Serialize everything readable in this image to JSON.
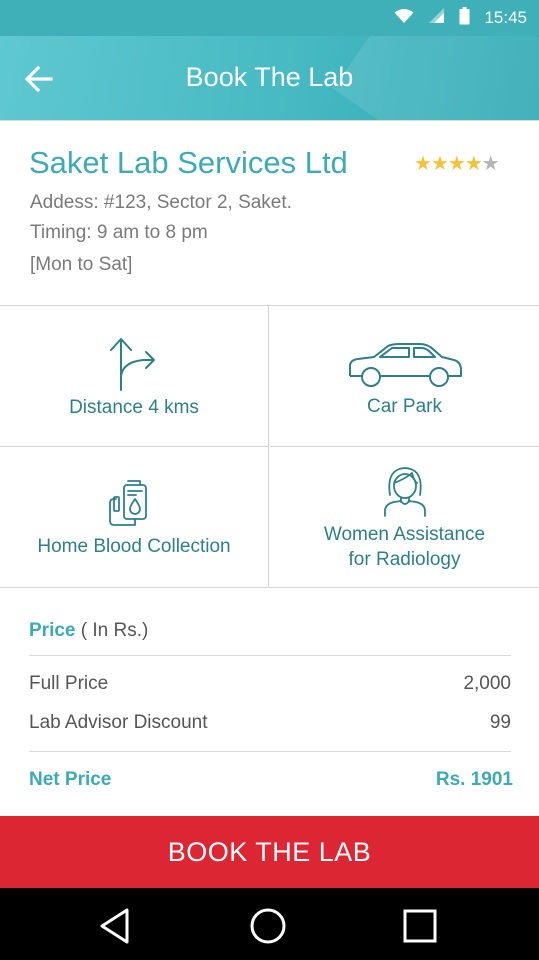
{
  "status_bar": {
    "time": "15:45",
    "icons": [
      "wifi-icon",
      "signal-icon",
      "battery-icon"
    ]
  },
  "app_bar": {
    "title": "Book The Lab",
    "back_icon": "arrow-left-icon"
  },
  "lab": {
    "name": "Saket Lab Services Ltd",
    "rating": {
      "value": 4,
      "max": 5
    },
    "address": "Addess: #123, Sector 2, Saket.",
    "timing": "Timing: 9 am to 8 pm",
    "days": "[Mon to Sat]"
  },
  "features": [
    {
      "label": "Distance 4 kms",
      "icon": "directions-arrow-icon"
    },
    {
      "label": "Car Park",
      "icon": "car-icon"
    },
    {
      "label": "Home Blood Collection",
      "icon": "blood-bag-icon"
    },
    {
      "label_line1": "Women Assistance",
      "label_line2": "for Radiology",
      "icon": "woman-icon"
    }
  ],
  "price": {
    "heading": "Price",
    "heading_unit": " ( In Rs.)",
    "rows": [
      {
        "label": "Full Price",
        "value": "2,000"
      },
      {
        "label": "Lab Advisor Discount",
        "value": "99"
      }
    ],
    "net_label": "Net Price",
    "net_value": "Rs. 1901"
  },
  "book_button": {
    "label": "BOOK THE LAB"
  },
  "nav_bar": {
    "icons": [
      "nav-back-icon",
      "nav-home-icon",
      "nav-recent-apps-icon"
    ]
  },
  "colors": {
    "accent": "#3eaab3",
    "app_bar": "#46b9c2",
    "book_button": "#dc2633",
    "star": "#f5c33b"
  }
}
